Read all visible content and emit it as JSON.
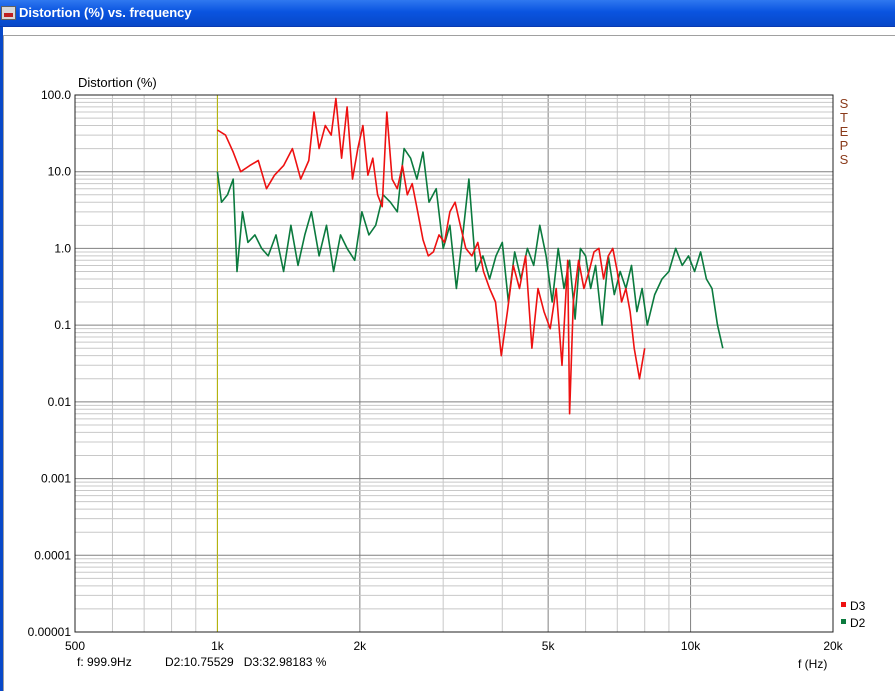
{
  "window": {
    "title": "Distortion (%) vs. frequency"
  },
  "status": {
    "frequency": "f: 999.9Hz",
    "values": "D2:10.75529   D3:32.98183 %"
  },
  "side_label": "STEPS",
  "colors": {
    "D3": "#ee1111",
    "D2": "#0b7a3e",
    "cursor": "#b8b800",
    "titlebar": "#0a54e0"
  },
  "chart_data": {
    "type": "line",
    "ylabel": "Distortion (%)",
    "xlabel": "f (Hz)",
    "x_scale": "log",
    "y_scale": "log",
    "xlim": [
      500,
      20000
    ],
    "ylim": [
      1e-05,
      100
    ],
    "x_ticks": [
      500,
      1000,
      2000,
      5000,
      10000,
      20000
    ],
    "x_tick_labels": [
      "500",
      "1k",
      "2k",
      "5k",
      "10k",
      "20k"
    ],
    "y_ticks": [
      1e-05,
      0.0001,
      0.001,
      0.01,
      0.1,
      1,
      10,
      100
    ],
    "y_tick_labels": [
      "0.00001",
      "0.0001",
      "0.001",
      "0.01",
      "0.1",
      "1.0",
      "10.0",
      "100.0"
    ],
    "grid": true,
    "cursor_x": 999.9,
    "legend": {
      "position": "bottom-right",
      "entries": [
        "D3",
        "D2"
      ]
    },
    "series": [
      {
        "name": "D3",
        "x": [
          1000,
          1040,
          1080,
          1120,
          1170,
          1220,
          1270,
          1320,
          1380,
          1440,
          1500,
          1560,
          1600,
          1640,
          1690,
          1740,
          1780,
          1830,
          1880,
          1930,
          1980,
          2030,
          2080,
          2130,
          2180,
          2230,
          2280,
          2340,
          2400,
          2460,
          2520,
          2580,
          2650,
          2720,
          2790,
          2860,
          2940,
          3020,
          3100,
          3180,
          3260,
          3350,
          3450,
          3550,
          3650,
          3760,
          3870,
          3980,
          4100,
          4220,
          4350,
          4480,
          4620,
          4760,
          4900,
          5050,
          5200,
          5350,
          5500,
          5550,
          5650,
          5800,
          5950,
          6100,
          6250,
          6400,
          6550,
          6700,
          6850,
          7000,
          7150,
          7300,
          7450,
          7600,
          7800,
          8000
        ],
        "y": [
          35,
          30,
          18,
          10,
          12,
          14,
          6,
          9,
          12,
          20,
          8,
          14,
          60,
          20,
          40,
          30,
          90,
          15,
          70,
          8,
          20,
          40,
          9,
          15,
          5,
          3.5,
          60,
          8,
          6,
          12,
          5,
          7,
          3,
          1.3,
          0.8,
          0.9,
          1.5,
          1.2,
          3,
          4,
          2,
          1.0,
          0.8,
          1.2,
          0.5,
          0.3,
          0.2,
          0.04,
          0.15,
          0.6,
          0.3,
          0.8,
          0.05,
          0.3,
          0.15,
          0.09,
          0.3,
          0.03,
          0.7,
          0.007,
          0.2,
          0.7,
          0.3,
          0.5,
          0.9,
          1.0,
          0.4,
          0.8,
          1.0,
          0.5,
          0.2,
          0.3,
          0.15,
          0.05,
          0.02,
          0.05
        ]
      },
      {
        "name": "D2",
        "x": [
          1000,
          1020,
          1050,
          1080,
          1100,
          1130,
          1160,
          1200,
          1240,
          1280,
          1330,
          1380,
          1430,
          1480,
          1530,
          1580,
          1640,
          1700,
          1760,
          1820,
          1880,
          1950,
          2020,
          2090,
          2160,
          2240,
          2320,
          2400,
          2480,
          2560,
          2640,
          2720,
          2800,
          2900,
          3000,
          3100,
          3200,
          3300,
          3400,
          3520,
          3640,
          3760,
          3880,
          4000,
          4120,
          4250,
          4380,
          4520,
          4660,
          4800,
          4950,
          5100,
          5250,
          5400,
          5550,
          5700,
          5850,
          6000,
          6150,
          6300,
          6500,
          6700,
          6900,
          7100,
          7300,
          7500,
          7700,
          7900,
          8100,
          8400,
          8700,
          9000,
          9300,
          9600,
          9900,
          10200,
          10500,
          10800,
          11100,
          11400,
          11700
        ],
        "y": [
          10,
          4,
          5,
          8,
          0.5,
          3,
          1.2,
          1.5,
          1.0,
          0.8,
          1.5,
          0.5,
          2,
          0.6,
          1.5,
          3,
          0.8,
          2,
          0.5,
          1.5,
          1.0,
          0.7,
          3,
          1.5,
          2,
          5,
          4,
          3,
          20,
          15,
          8,
          18,
          4,
          6,
          1.0,
          2,
          0.3,
          1.5,
          8,
          0.5,
          0.8,
          0.4,
          0.8,
          1.2,
          0.2,
          0.9,
          0.4,
          1.0,
          0.6,
          2,
          0.8,
          0.2,
          1.0,
          0.3,
          0.7,
          0.12,
          1.0,
          0.8,
          0.3,
          0.6,
          0.1,
          0.8,
          0.25,
          0.5,
          0.3,
          0.6,
          0.15,
          0.3,
          0.1,
          0.25,
          0.4,
          0.5,
          1.0,
          0.6,
          0.8,
          0.5,
          0.9,
          0.4,
          0.3,
          0.1,
          0.05
        ]
      }
    ]
  }
}
